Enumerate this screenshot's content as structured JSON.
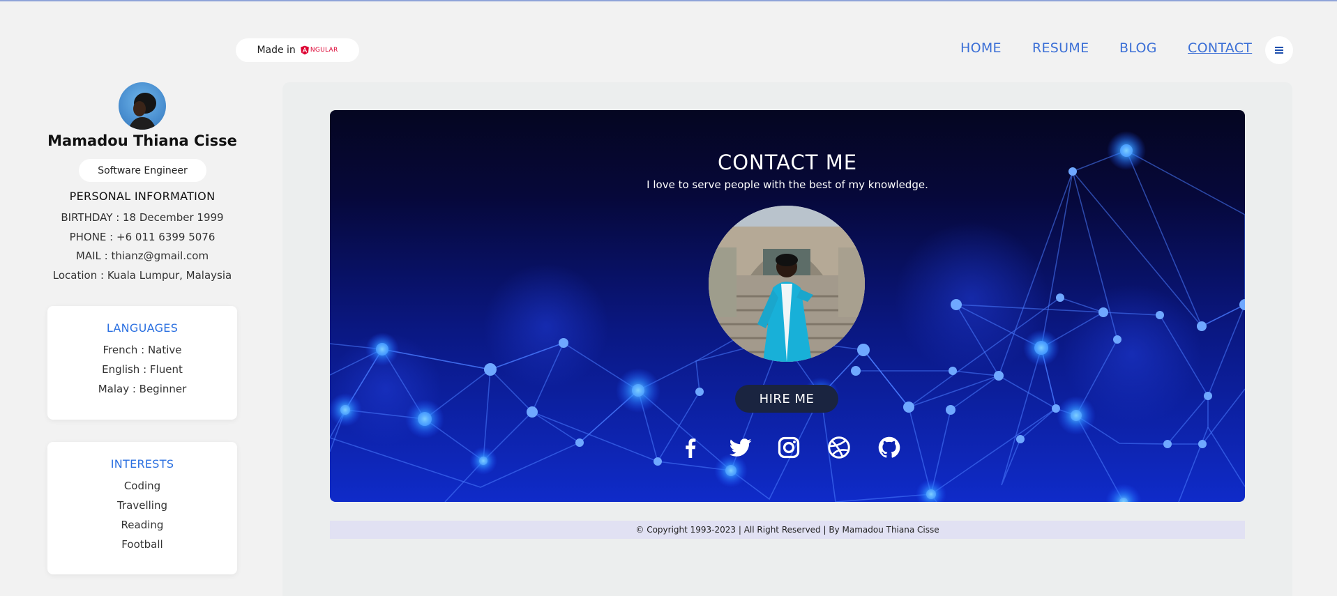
{
  "badge": {
    "made_in": "Made in",
    "framework": "NGULAR"
  },
  "nav": {
    "items": [
      {
        "label": "HOME"
      },
      {
        "label": "RESUME"
      },
      {
        "label": "BLOG"
      },
      {
        "label": "CONTACT"
      }
    ],
    "active": "CONTACT",
    "accent_color": "#3b6fd6"
  },
  "profile": {
    "name": "Mamadou Thiana Cisse",
    "role": "Software Engineer",
    "personal_title": "PERSONAL INFORMATION",
    "birthday": "BIRTHDAY : 18 December 1999",
    "phone": "PHONE : +6 011 6399 5076",
    "mail": "MAIL : thianz@gmail.com",
    "location": "Location : Kuala Lumpur, Malaysia"
  },
  "languages": {
    "title": "LANGUAGES",
    "items": [
      "French : Native",
      "English : Fluent",
      "Malay : Beginner"
    ]
  },
  "interests": {
    "title": "INTERESTS",
    "items": [
      "Coding",
      "Travelling",
      "Reading",
      "Football"
    ]
  },
  "hero": {
    "title": "CONTACT ME",
    "subtitle": "I love to serve people with the best of my knowledge.",
    "cta": "HIRE ME",
    "socials": [
      "facebook-icon",
      "twitter-icon",
      "instagram-icon",
      "dribbble-icon",
      "github-icon"
    ]
  },
  "footer": {
    "text": "© Copyright 1993-2023 | All Right Reserved | By Mamadou Thiana Cisse"
  },
  "colors": {
    "link": "#3b6fd6",
    "section_title": "#2a6fe0",
    "cta_bg": "#1a2440",
    "footer_bg": "#e1e1f3"
  }
}
